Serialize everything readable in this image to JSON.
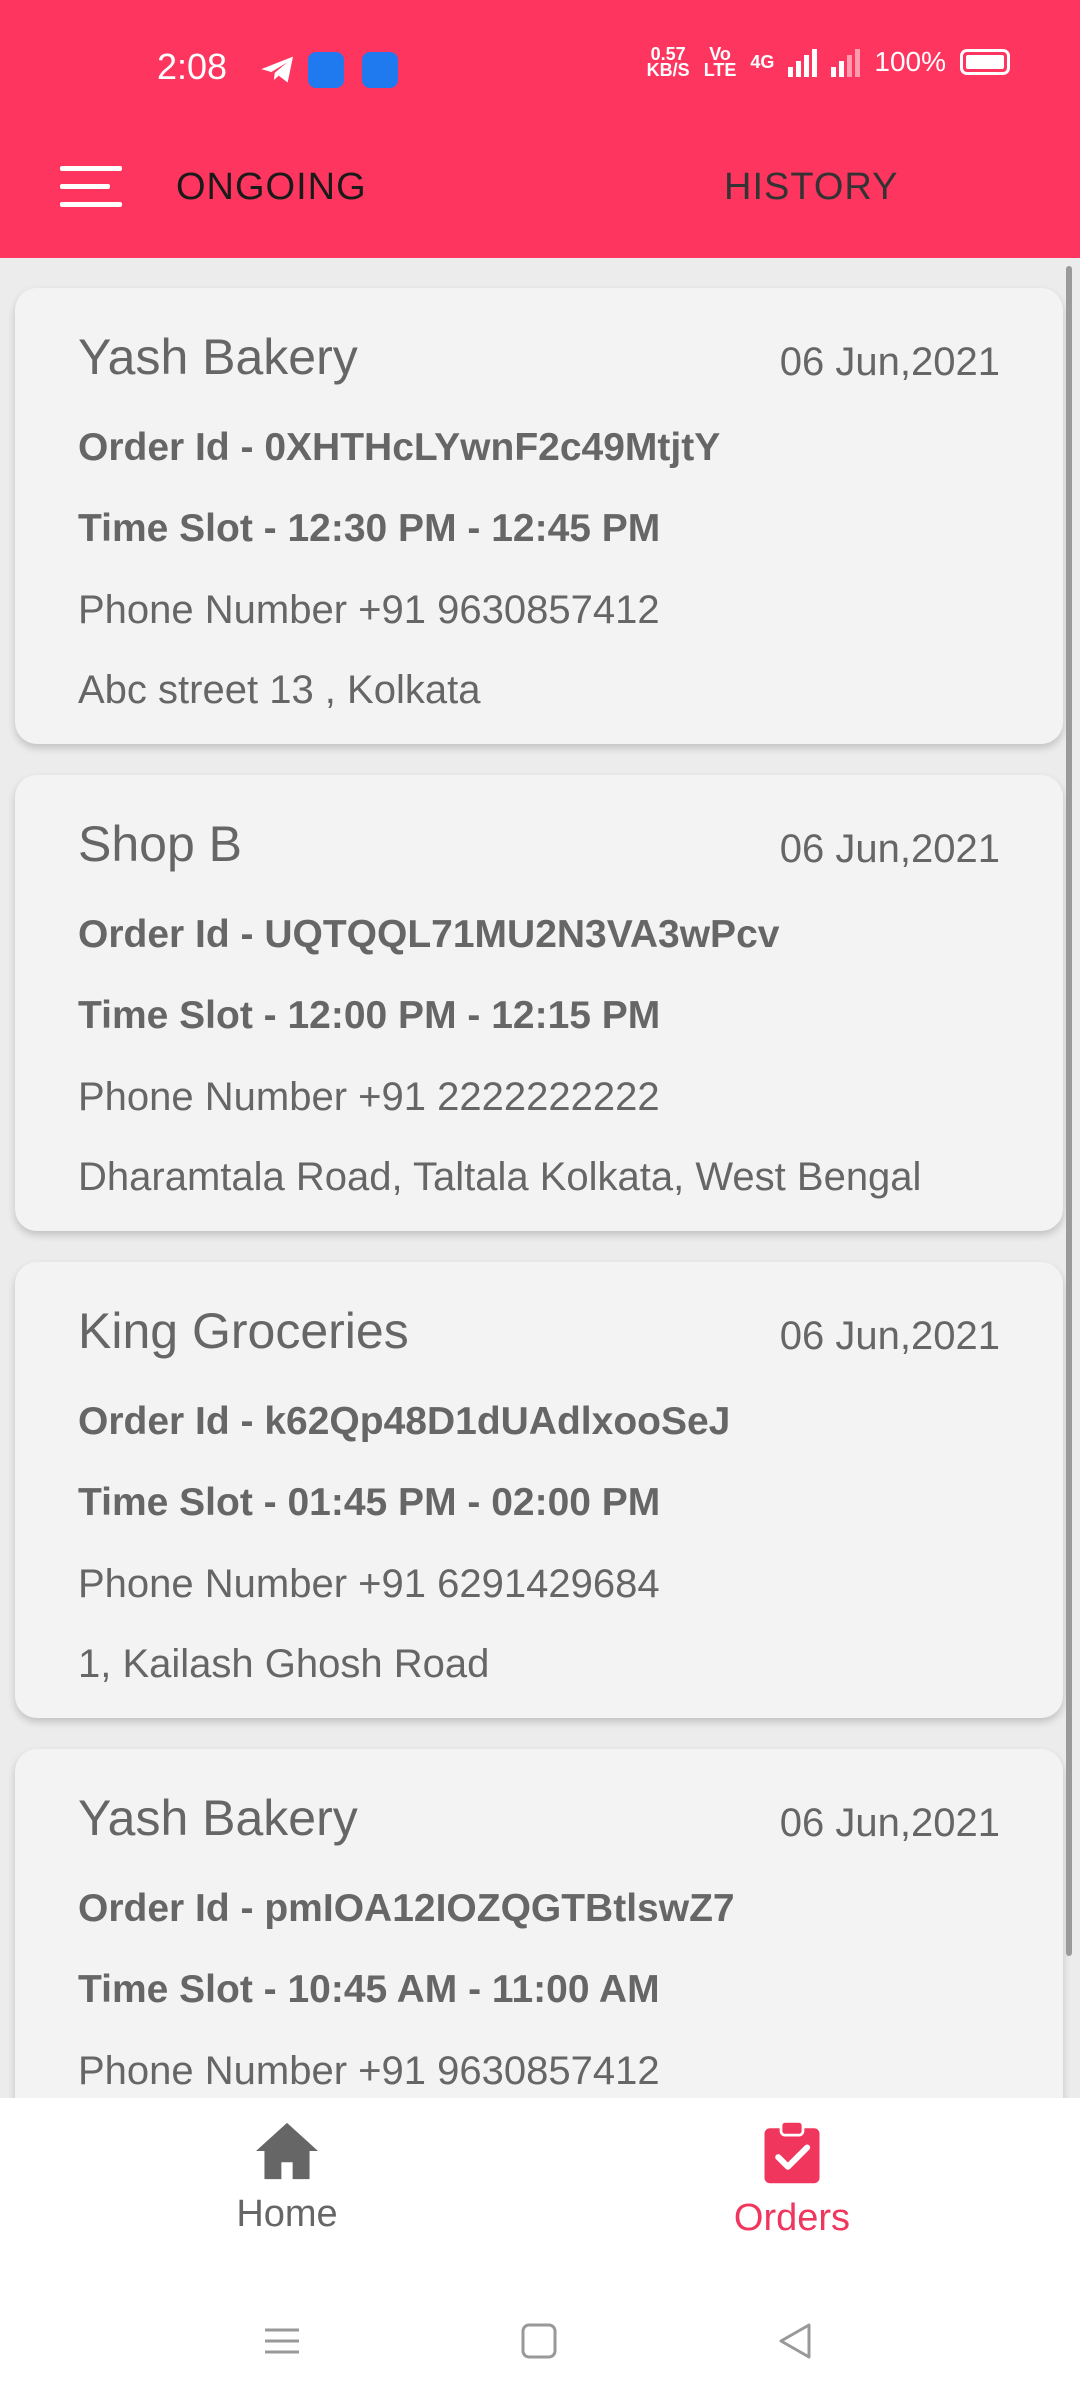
{
  "status_bar": {
    "time": "2:08",
    "speed_value": "0.57",
    "speed_unit": "KB/S",
    "volte_top": "Vo",
    "volte_bottom": "LTE",
    "network": "4G",
    "battery": "100%"
  },
  "header": {
    "tabs": [
      {
        "label": "ONGOING",
        "active": true
      },
      {
        "label": "HISTORY",
        "active": false
      }
    ]
  },
  "orders": [
    {
      "shop": "Yash Bakery",
      "date": "06 Jun,2021",
      "order_id": "Order Id - 0XHTHcLYwnF2c49MtjtY",
      "time_slot": "Time Slot - 12:30 PM - 12:45 PM",
      "phone": "Phone Number  +91 9630857412",
      "address": "Abc street 13 , Kolkata"
    },
    {
      "shop": "Shop B",
      "date": "06 Jun,2021",
      "order_id": "Order Id - UQTQQL71MU2N3VA3wPcv",
      "time_slot": "Time Slot - 12:00 PM - 12:15 PM",
      "phone": "Phone Number  +91 2222222222",
      "address": "Dharamtala Road, Taltala Kolkata, West Bengal"
    },
    {
      "shop": "King Groceries",
      "date": "06 Jun,2021",
      "order_id": "Order Id - k62Qp48D1dUAdlxooSeJ",
      "time_slot": "Time Slot - 01:45 PM - 02:00 PM",
      "phone": "Phone Number  +91 6291429684",
      "address": "1, Kailash Ghosh Road"
    },
    {
      "shop": "Yash Bakery",
      "date": "06 Jun,2021",
      "order_id": "Order Id - pmIOA12IOZQGTBtlswZ7",
      "time_slot": "Time Slot - 10:45 AM - 11:00 AM",
      "phone": "Phone Number  +91 9630857412",
      "address": ""
    }
  ],
  "bottom_nav": {
    "items": [
      {
        "label": "Home",
        "icon": "home-icon",
        "active": false
      },
      {
        "label": "Orders",
        "icon": "clipboard-check-icon",
        "active": true
      }
    ]
  },
  "colors": {
    "accent": "#fe355f",
    "active_nav": "#f0365d",
    "card_bg": "#f3f3f3",
    "text_gray": "#666666"
  }
}
